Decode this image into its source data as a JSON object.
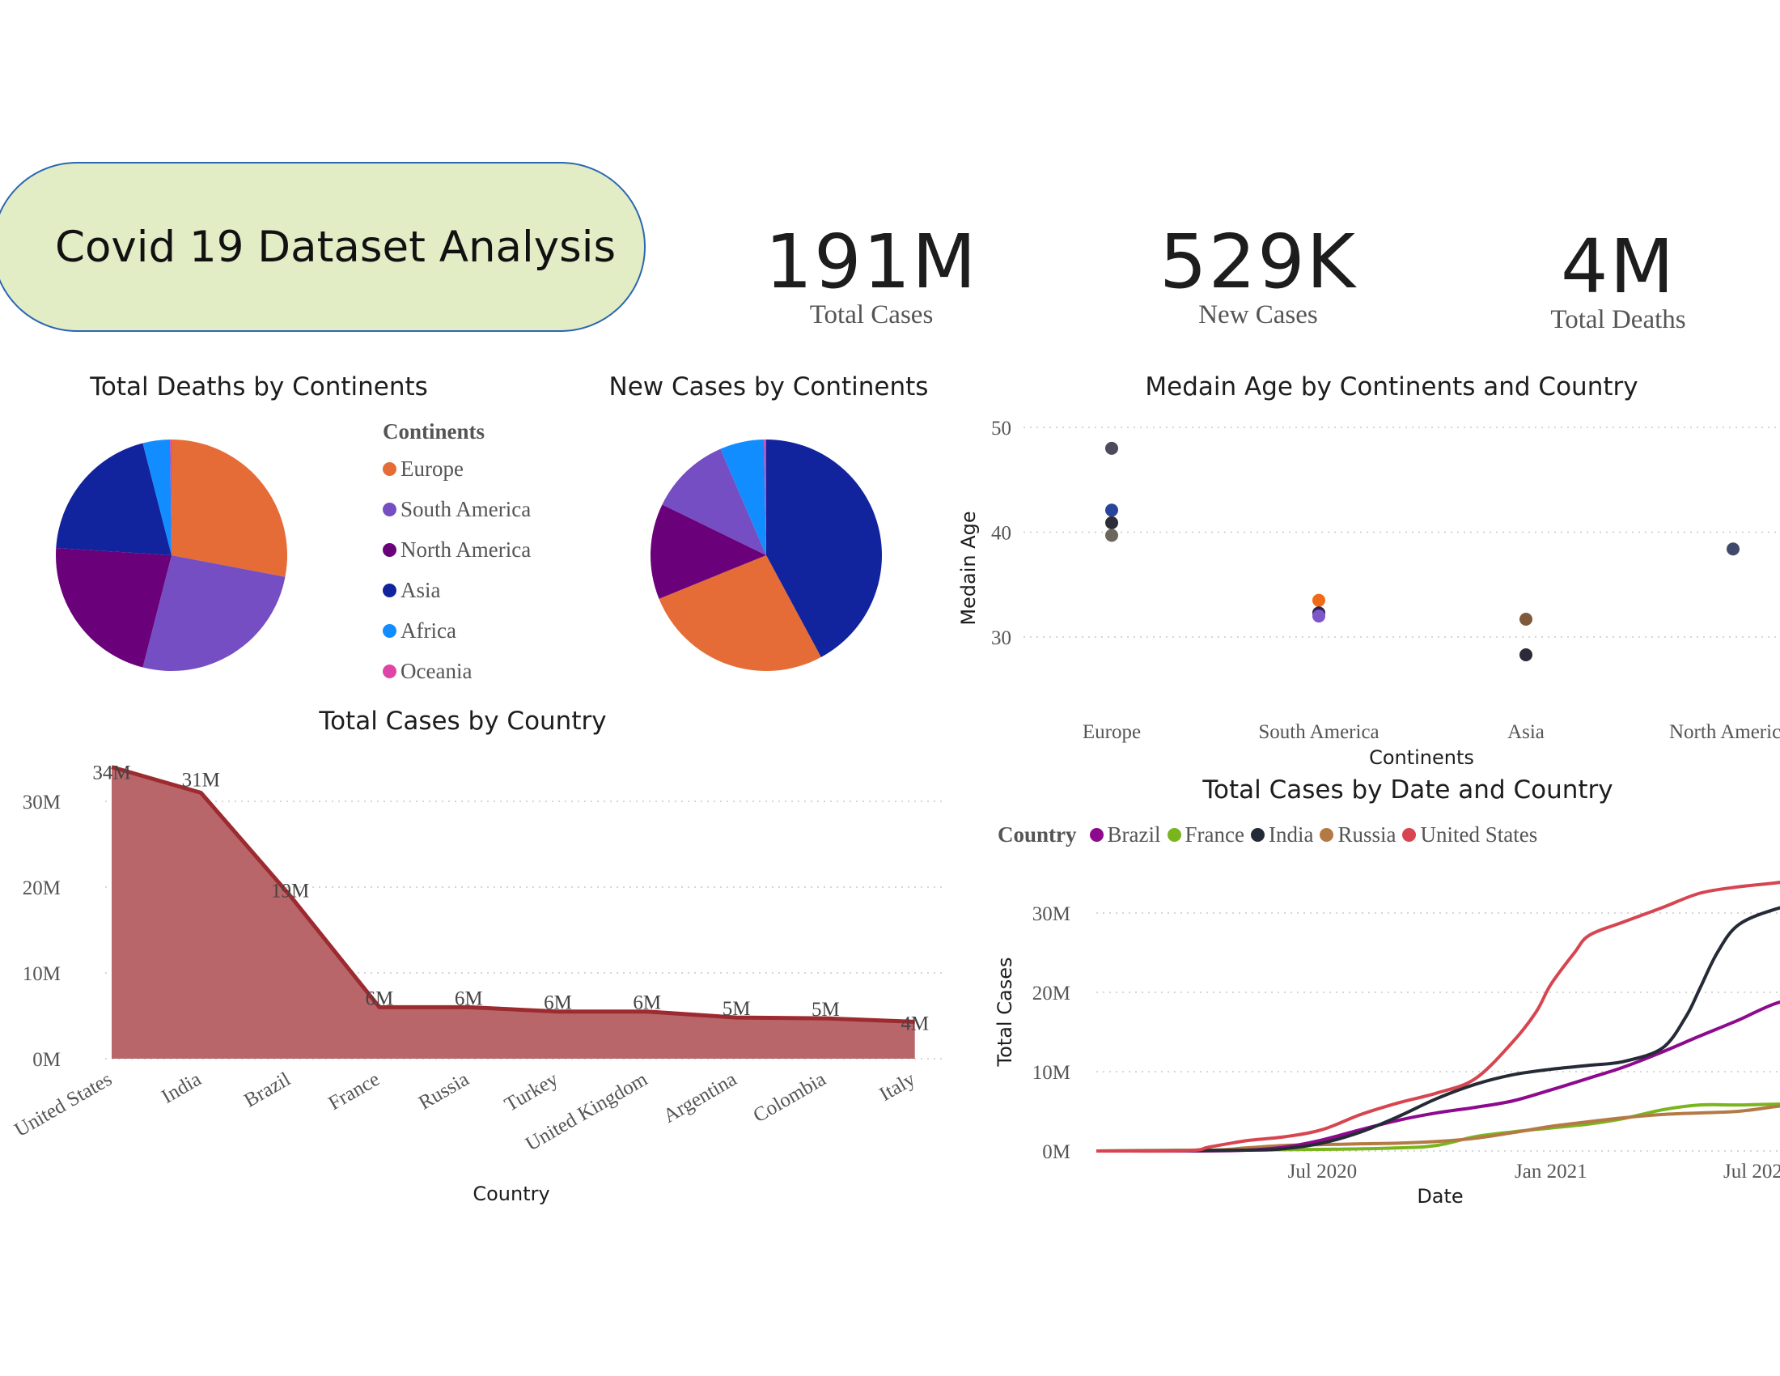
{
  "header": {
    "title": "Covid 19 Dataset Analysis"
  },
  "kpis": [
    {
      "value": "191M",
      "label": "Total Cases"
    },
    {
      "value": "529K",
      "label": "New Cases"
    },
    {
      "value": "4M",
      "label": "Total Deaths"
    }
  ],
  "colors": {
    "europe": "#e56c37",
    "south_america": "#744ec2",
    "north_america": "#6b007b",
    "asia": "#12239e",
    "africa": "#118dff",
    "oceania": "#e044a7",
    "area_fill": "#b9666b",
    "area_line": "#9c2b30",
    "brazil": "#8d0a8d",
    "france": "#7ab51d",
    "india": "#252a37",
    "russia": "#b47a45",
    "united_states": "#d64550"
  },
  "legend_continents": {
    "title": "Continents",
    "items": [
      {
        "label": "Europe",
        "color": "#e56c37"
      },
      {
        "label": "South America",
        "color": "#744ec2"
      },
      {
        "label": "North America",
        "color": "#6b007b"
      },
      {
        "label": "Asia",
        "color": "#12239e"
      },
      {
        "label": "Africa",
        "color": "#118dff"
      },
      {
        "label": "Oceania",
        "color": "#e044a7"
      }
    ]
  },
  "legend_country": {
    "title": "Country",
    "items": [
      {
        "label": "Brazil",
        "color": "#8d0a8d"
      },
      {
        "label": "France",
        "color": "#7ab51d"
      },
      {
        "label": "India",
        "color": "#252a37"
      },
      {
        "label": "Russia",
        "color": "#b47a45"
      },
      {
        "label": "United States",
        "color": "#d64550"
      }
    ]
  },
  "chart_data": [
    {
      "type": "pie",
      "title": "Total Deaths by Continents",
      "categories": [
        "Europe",
        "South America",
        "North America",
        "Asia",
        "Africa",
        "Oceania"
      ],
      "values": [
        28,
        26,
        22,
        20,
        3.8,
        0.2
      ]
    },
    {
      "type": "pie",
      "title": "New Cases by Continents",
      "categories": [
        "Asia",
        "Europe",
        "North America",
        "South America",
        "Africa",
        "Oceania"
      ],
      "values": [
        41,
        26,
        13,
        11,
        6,
        0.3
      ]
    },
    {
      "type": "scatter",
      "title": "Medain Age by Continents and Country",
      "xlabel": "Continents",
      "ylabel": "Medain Age",
      "categories": [
        "Europe",
        "South America",
        "Asia",
        "North Americ"
      ],
      "ylim": [
        25,
        50
      ],
      "yticks": [
        "30",
        "40",
        "50"
      ],
      "grid": true,
      "points": [
        {
          "x": "Europe",
          "y": 48.0,
          "color": "#4b4b5b"
        },
        {
          "x": "Europe",
          "y": 42.1,
          "color": "#27459a"
        },
        {
          "x": "Europe",
          "y": 40.9,
          "color": "#2d2d3a"
        },
        {
          "x": "Europe",
          "y": 39.7,
          "color": "#6e655d"
        },
        {
          "x": "South America",
          "y": 33.5,
          "color": "#f06a18"
        },
        {
          "x": "South America",
          "y": 32.3,
          "color": "#2a2254"
        },
        {
          "x": "South America",
          "y": 32.0,
          "color": "#7d56c9"
        },
        {
          "x": "Asia",
          "y": 31.7,
          "color": "#7f5a3a"
        },
        {
          "x": "Asia",
          "y": 28.3,
          "color": "#2b2b38"
        },
        {
          "x": "North Americ",
          "y": 38.4,
          "color": "#3f4a6b"
        }
      ]
    },
    {
      "type": "area",
      "title": "Total Cases by Country",
      "xlabel": "Country",
      "ylabel": "",
      "categories": [
        "United States",
        "India",
        "Brazil",
        "France",
        "Russia",
        "Turkey",
        "United Kingdom",
        "Argentina",
        "Colombia",
        "Italy"
      ],
      "values": [
        34,
        31,
        19,
        6,
        6,
        5.5,
        5.5,
        4.8,
        4.7,
        4.3
      ],
      "labels": [
        "34M",
        "31M",
        "19M",
        "6M",
        "6M",
        "6M",
        "6M",
        "5M",
        "5M",
        "4M"
      ],
      "yticks": [
        "0M",
        "10M",
        "20M",
        "30M"
      ],
      "ylim": [
        0,
        36
      ],
      "grid": true
    },
    {
      "type": "line",
      "title": "Total Cases by Date and Country",
      "xlabel": "Date",
      "ylabel": "Total Cases",
      "xticks": [
        "Jul 2020",
        "Jan 2021",
        "Jul 202"
      ],
      "yticks": [
        "0M",
        "10M",
        "20M",
        "30M"
      ],
      "ylim": [
        0,
        36
      ],
      "legend": "top",
      "series": [
        {
          "name": "Brazil",
          "x": [
            "2020-01-01",
            "2020-03-15",
            "2020-05-01",
            "2020-06-01",
            "2020-07-01",
            "2020-08-01",
            "2020-09-01",
            "2020-10-01",
            "2020-11-01",
            "2020-12-01",
            "2021-01-01",
            "2021-02-01",
            "2021-03-01",
            "2021-04-01",
            "2021-05-01",
            "2021-06-01",
            "2021-07-01",
            "2021-08-01"
          ],
          "values": [
            0,
            0,
            0.1,
            0.5,
            1.4,
            2.7,
            3.9,
            4.8,
            5.5,
            6.3,
            7.7,
            9.2,
            10.6,
            12.5,
            14.5,
            16.5,
            18.6,
            19.7
          ]
        },
        {
          "name": "France",
          "x": [
            "2020-01-01",
            "2020-04-01",
            "2020-07-01",
            "2020-09-01",
            "2020-10-01",
            "2020-11-01",
            "2020-12-01",
            "2021-01-01",
            "2021-02-01",
            "2021-03-01",
            "2021-04-01",
            "2021-05-01",
            "2021-06-01",
            "2021-07-01",
            "2021-08-01"
          ],
          "values": [
            0,
            0.1,
            0.2,
            0.4,
            0.7,
            1.8,
            2.4,
            2.9,
            3.4,
            4.1,
            5.2,
            5.8,
            5.8,
            5.9,
            6.0
          ]
        },
        {
          "name": "India",
          "x": [
            "2020-01-01",
            "2020-05-01",
            "2020-06-01",
            "2020-07-01",
            "2020-08-01",
            "2020-09-01",
            "2020-10-01",
            "2020-11-01",
            "2020-12-01",
            "2021-01-01",
            "2021-02-01",
            "2021-03-01",
            "2021-04-01",
            "2021-04-20",
            "2021-05-01",
            "2021-05-15",
            "2021-06-01",
            "2021-07-01",
            "2021-08-01"
          ],
          "values": [
            0,
            0.1,
            0.3,
            1.0,
            2.4,
            4.4,
            6.6,
            8.4,
            9.6,
            10.3,
            10.8,
            11.3,
            13,
            17,
            20.5,
            25,
            28.5,
            30.5,
            31.5
          ]
        },
        {
          "name": "Russia",
          "x": [
            "2020-01-01",
            "2020-04-01",
            "2020-05-01",
            "2020-06-01",
            "2020-07-01",
            "2020-08-01",
            "2020-09-01",
            "2020-10-01",
            "2020-11-01",
            "2020-12-01",
            "2021-01-01",
            "2021-02-01",
            "2021-03-01",
            "2021-04-01",
            "2021-05-01",
            "2021-06-01",
            "2021-07-01",
            "2021-08-01"
          ],
          "values": [
            0,
            0.1,
            0.4,
            0.7,
            0.8,
            0.9,
            1.0,
            1.2,
            1.6,
            2.3,
            3.1,
            3.7,
            4.2,
            4.6,
            4.8,
            5.0,
            5.6,
            6.2
          ]
        },
        {
          "name": "United States",
          "x": [
            "2020-01-01",
            "2020-03-15",
            "2020-04-01",
            "2020-05-01",
            "2020-06-01",
            "2020-07-01",
            "2020-08-01",
            "2020-09-01",
            "2020-10-01",
            "2020-11-01",
            "2020-12-01",
            "2020-12-20",
            "2021-01-01",
            "2021-01-20",
            "2021-02-01",
            "2021-03-01",
            "2021-04-01",
            "2021-05-01",
            "2021-06-01",
            "2021-07-01",
            "2021-08-01"
          ],
          "values": [
            0,
            0.05,
            0.5,
            1.3,
            1.8,
            2.7,
            4.6,
            6.1,
            7.3,
            9.1,
            13.7,
            17.5,
            21,
            25,
            27.2,
            28.9,
            30.7,
            32.5,
            33.3,
            33.8,
            34.5
          ]
        }
      ]
    }
  ]
}
